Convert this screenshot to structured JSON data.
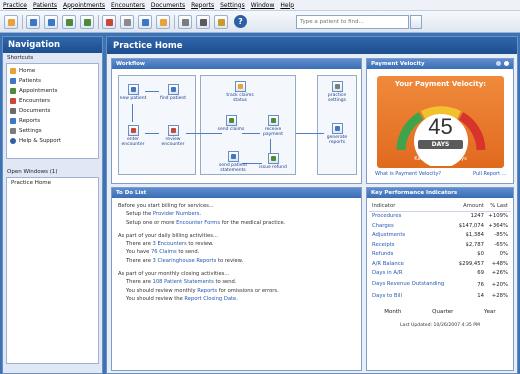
{
  "menu": [
    "Practice",
    "Patients",
    "Appointments",
    "Encounters",
    "Documents",
    "Reports",
    "Settings",
    "Window",
    "Help"
  ],
  "toolbar_icons": [
    "home-icon",
    "users-icon",
    "calendar-icon",
    "encounter-icon",
    "document-icon",
    "report-icon",
    "settings-icon",
    "print-icon",
    "lock-icon",
    "help-icon"
  ],
  "search": {
    "placeholder": "Type a patient to find..."
  },
  "nav": {
    "title": "Navigation",
    "shortcuts_label": "Shortcuts",
    "items": [
      {
        "label": "Home",
        "color": "#e8a23a"
      },
      {
        "label": "Patients",
        "color": "#3f77c4"
      },
      {
        "label": "Appointments",
        "color": "#4f8a3a"
      },
      {
        "label": "Encounters",
        "color": "#c9463a"
      },
      {
        "label": "Documents",
        "color": "#6b6b6b"
      },
      {
        "label": "Reports",
        "color": "#3f77c4"
      },
      {
        "label": "Settings",
        "color": "#7c7c7c"
      },
      {
        "label": "Help & Support",
        "color": "#2c5fa8"
      }
    ],
    "open_windows_label": "Open Windows (1)",
    "open_windows": [
      "Practice Home"
    ]
  },
  "main": {
    "title": "Practice Home"
  },
  "workflow": {
    "title": "Workflow",
    "items": [
      {
        "label": "new patient",
        "color": "#3f77c4"
      },
      {
        "label": "find patient",
        "color": "#3f77c4"
      },
      {
        "label": "enter encounter",
        "color": "#c9463a"
      },
      {
        "label": "review encounter",
        "color": "#c9463a"
      },
      {
        "label": "track claims status",
        "color": "#e8a23a"
      },
      {
        "label": "send claims",
        "color": "#4f8a3a"
      },
      {
        "label": "receive payment",
        "color": "#4f8a3a"
      },
      {
        "label": "send patient statements",
        "color": "#3f77c4"
      },
      {
        "label": "issue refund",
        "color": "#4f8a3a"
      },
      {
        "label": "practice settings",
        "color": "#7c7c7c"
      },
      {
        "label": "generate reports",
        "color": "#3f77c4"
      }
    ]
  },
  "velocity": {
    "title": "Payment Velocity",
    "heading": "Your Payment Velocity:",
    "value": "45",
    "unit": "DAYS",
    "best": "Kareo Best: 33 Days",
    "link1": "What is Payment Velocity?",
    "link2": "Pull Report ..."
  },
  "todo": {
    "title": "To Do List",
    "lines": [
      {
        "text": "Before you start billing for services...",
        "indent": false
      },
      {
        "pre": "Setup the ",
        "link": "Provider Numbers",
        "post": ".",
        "indent": true
      },
      {
        "pre": "Setup one or more ",
        "link": "Encounter Forms",
        "post": " for the medical practice.",
        "indent": true
      },
      {
        "text": "",
        "indent": false
      },
      {
        "text": "As part of your daily billing activities...",
        "indent": false
      },
      {
        "pre": "There are ",
        "link": "3 Encounters",
        "post": " to review.",
        "indent": true
      },
      {
        "pre": "You have ",
        "link": "76 Claims",
        "post": " to send.",
        "indent": true
      },
      {
        "pre": "There are ",
        "link": "3 Clearinghouse Reports",
        "post": " to review.",
        "indent": true
      },
      {
        "text": "",
        "indent": false
      },
      {
        "text": "As part of your monthly closing activities...",
        "indent": false
      },
      {
        "pre": "There are ",
        "link": "108 Patient Statements",
        "post": " to send.",
        "indent": true
      },
      {
        "pre": "You should review monthly ",
        "link": "Reports",
        "post": " for omissions or errors.",
        "indent": true
      },
      {
        "pre": "You should review the ",
        "link": "Report Closing Date",
        "post": ".",
        "indent": true
      }
    ]
  },
  "kpi": {
    "title": "Key Performance Indicators",
    "headers": [
      "Indicator",
      "Amount",
      "% Last"
    ],
    "rows": [
      [
        "Procedures",
        "1247",
        "+109%"
      ],
      [
        "Charges",
        "$147,074",
        "+364%"
      ],
      [
        "Adjustments",
        "$1,384",
        "-85%"
      ],
      [
        "Receipts",
        "$2,787",
        "-65%"
      ],
      [
        "Refunds",
        "$0",
        "0%"
      ],
      [
        "A/R Balance",
        "$299,457",
        "+48%"
      ],
      [
        "Days in A/R",
        "69",
        "+26%"
      ],
      [
        "Days Revenue Outstanding",
        "76",
        "+20%"
      ],
      [
        "Days to Bill",
        "14",
        "+28%"
      ]
    ],
    "periods": [
      "Month",
      "Quarter",
      "Year"
    ],
    "updated": "Last Updated: 10/26/2007 4:35 PM"
  }
}
